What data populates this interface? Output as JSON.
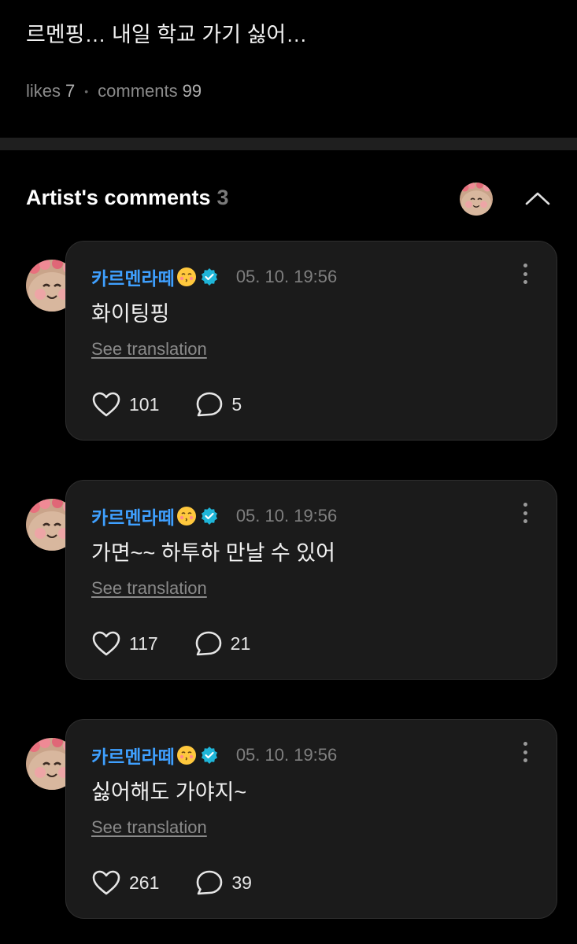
{
  "post": {
    "text": "르멘핑… 내일 학교 가기 싫어…",
    "likes_label": "likes",
    "likes": "7",
    "comments_label": "comments",
    "comments": "99"
  },
  "artist_comments": {
    "title": "Artist's comments",
    "count": "3"
  },
  "comments": [
    {
      "author": "카르멘라떼",
      "time": "05. 10. 19:56",
      "body": "화이팅핑",
      "translate": "See translation",
      "likes": "101",
      "replies": "5"
    },
    {
      "author": "카르멘라떼",
      "time": "05. 10. 19:56",
      "body": "가면~~ 하투하 만날 수 있어",
      "translate": "See translation",
      "likes": "117",
      "replies": "21"
    },
    {
      "author": "카르멘라떼",
      "time": "05. 10. 19:56",
      "body": "싫어해도 가야지~",
      "translate": "See translation",
      "likes": "261",
      "replies": "39"
    }
  ],
  "icons": {
    "like": "heart-icon",
    "reply": "speech-bubble-icon",
    "more": "more-vertical-icon",
    "verified": "verified-badge-icon",
    "emoji": "kissing-face-emoji",
    "collapse": "chevron-up-icon"
  },
  "colors": {
    "author": "#3fa0ff",
    "verified": "#1fb5d8",
    "background": "#000000",
    "card": "#1b1b1b"
  }
}
